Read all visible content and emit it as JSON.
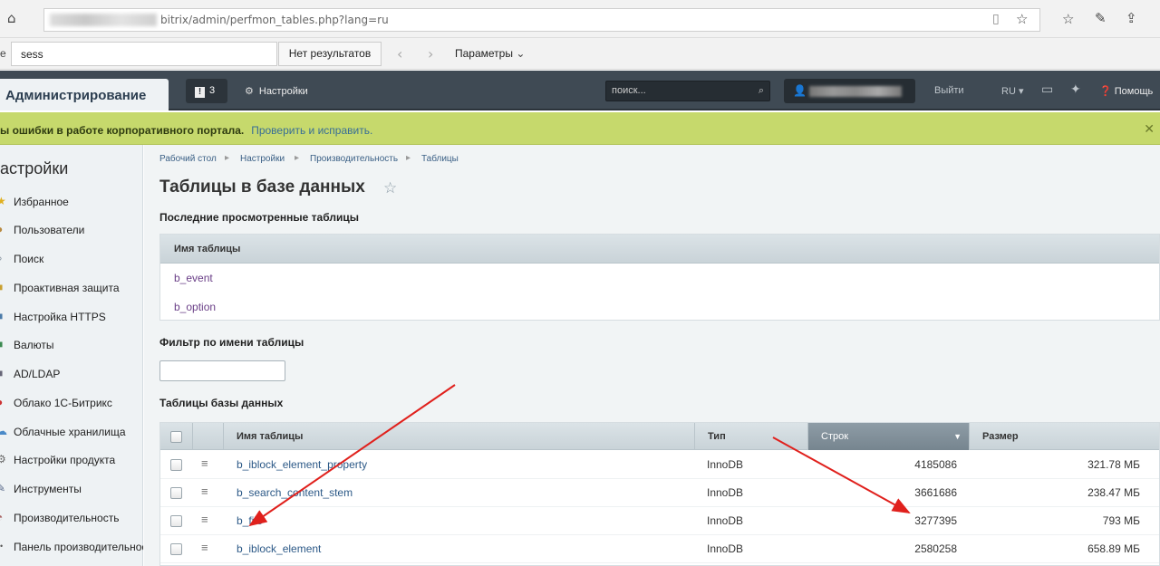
{
  "browser": {
    "url": "bitrix/admin/perfmon_tables.php?lang=ru",
    "find": {
      "value": "sess",
      "result": "Нет результатов",
      "params_label": "Параметры"
    }
  },
  "admin_panel": {
    "title": "Администрирование",
    "notifications": "3",
    "settings_label": "Настройки",
    "search_placeholder": "поиск...",
    "logout": "Выйти",
    "lang": "RU",
    "help": "Помощь"
  },
  "warning": {
    "text": "ы ошибки в работе корпоративного портала.",
    "link": "Проверить и исправить."
  },
  "sidebar": {
    "title": "астройки",
    "items": [
      {
        "label": "Избранное",
        "icon": "star-icon"
      },
      {
        "label": "Пользователи",
        "icon": "user-icon"
      },
      {
        "label": "Поиск",
        "icon": "search-icon"
      },
      {
        "label": "Проактивная защита",
        "icon": "lock-icon"
      },
      {
        "label": "Настройка HTTPS",
        "icon": "https-icon"
      },
      {
        "label": "Валюты",
        "icon": "currency-icon"
      },
      {
        "label": "AD/LDAP",
        "icon": "ldap-icon"
      },
      {
        "label": "Облако 1С-Битрикс",
        "icon": "cloud-icon"
      },
      {
        "label": "Облачные хранилища",
        "icon": "cloud-storage-icon"
      },
      {
        "label": "Настройки продукта",
        "icon": "gear-icon"
      },
      {
        "label": "Инструменты",
        "icon": "tools-icon"
      },
      {
        "label": "Производительность",
        "icon": "gauge-icon"
      },
      {
        "label": "Панель производительности",
        "icon": "dot-icon"
      }
    ]
  },
  "breadcrumb": [
    "Рабочий стол",
    "Настройки",
    "Производительность",
    "Таблицы"
  ],
  "page_title": "Таблицы в базе данных",
  "recent": {
    "heading": "Последние просмотренные таблицы",
    "column": "Имя таблицы",
    "rows": [
      "b_event",
      "b_option"
    ]
  },
  "filter": {
    "label": "Фильтр по имени таблицы",
    "value": ""
  },
  "db_tables": {
    "heading": "Таблицы базы данных",
    "columns": {
      "name": "Имя таблицы",
      "type": "Тип",
      "rows": "Строк",
      "size": "Размер"
    },
    "rows": [
      {
        "name": "b_iblock_element_property",
        "type": "InnoDB",
        "rows": "4185086",
        "size": "321.78 МБ"
      },
      {
        "name": "b_search_content_stem",
        "type": "InnoDB",
        "rows": "3661686",
        "size": "238.47 МБ"
      },
      {
        "name": "b_file",
        "type": "InnoDB",
        "rows": "3277395",
        "size": "793 МБ"
      },
      {
        "name": "b_iblock_element",
        "type": "InnoDB",
        "rows": "2580258",
        "size": "658.89 МБ"
      }
    ]
  },
  "colors": {
    "accent_arrow": "#e0201c",
    "warning_bg": "#c6d96c",
    "panel_bg": "#3f4a54"
  }
}
